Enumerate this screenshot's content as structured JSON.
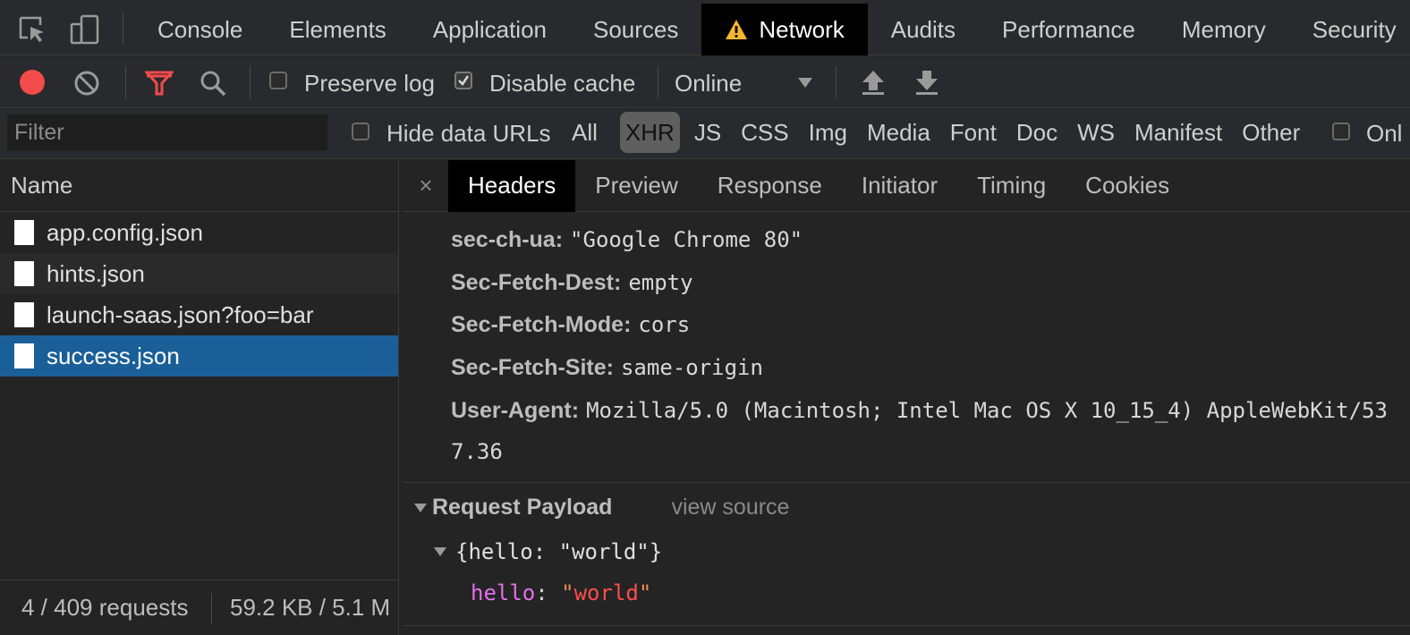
{
  "top_tabs": [
    {
      "label": "Console"
    },
    {
      "label": "Elements"
    },
    {
      "label": "Application"
    },
    {
      "label": "Sources"
    },
    {
      "label": "Network",
      "active": true,
      "icon": "warning-icon"
    },
    {
      "label": "Audits"
    },
    {
      "label": "Performance"
    },
    {
      "label": "Memory"
    },
    {
      "label": "Security"
    }
  ],
  "toolbar": {
    "preserve_log_label": "Preserve log",
    "preserve_log_checked": false,
    "disable_cache_label": "Disable cache",
    "disable_cache_checked": true,
    "throttle_value": "Online",
    "record_color": "#f44b4b",
    "filter_icon_color": "#f44b4b"
  },
  "filterbar": {
    "filter_placeholder": "Filter",
    "hide_data_urls_label": "Hide data URLs",
    "types": [
      "All",
      "XHR",
      "JS",
      "CSS",
      "Img",
      "Media",
      "Font",
      "Doc",
      "WS",
      "Manifest",
      "Other"
    ],
    "selected_type": "XHR",
    "only_label": "Onl"
  },
  "requests": {
    "column_name": "Name",
    "items": [
      {
        "name": "app.config.json"
      },
      {
        "name": "hints.json"
      },
      {
        "name": "launch-saas.json?foo=bar"
      },
      {
        "name": "success.json",
        "selected": true
      }
    ],
    "status_count": "4 / 409 requests",
    "status_size": "59.2 KB / 5.1 M"
  },
  "detail": {
    "close_label": "×",
    "tabs": [
      "Headers",
      "Preview",
      "Response",
      "Initiator",
      "Timing",
      "Cookies"
    ],
    "active_tab": "Headers",
    "headers": [
      {
        "key": "sec-ch-ua:",
        "value": "\"Google Chrome 80\""
      },
      {
        "key": "Sec-Fetch-Dest:",
        "value": "empty"
      },
      {
        "key": "Sec-Fetch-Mode:",
        "value": "cors"
      },
      {
        "key": "Sec-Fetch-Site:",
        "value": "same-origin"
      },
      {
        "key": "User-Agent:",
        "value": "Mozilla/5.0 (Macintosh; Intel Mac OS X 10_15_4) AppleWebKit/53"
      }
    ],
    "user_agent_wrap": "7.36",
    "payload": {
      "title": "Request Payload",
      "view_source": "view source",
      "object_summary": "{hello: \"world\"}",
      "prop_key": "hello",
      "prop_colon": ": ",
      "prop_value": "world"
    }
  }
}
